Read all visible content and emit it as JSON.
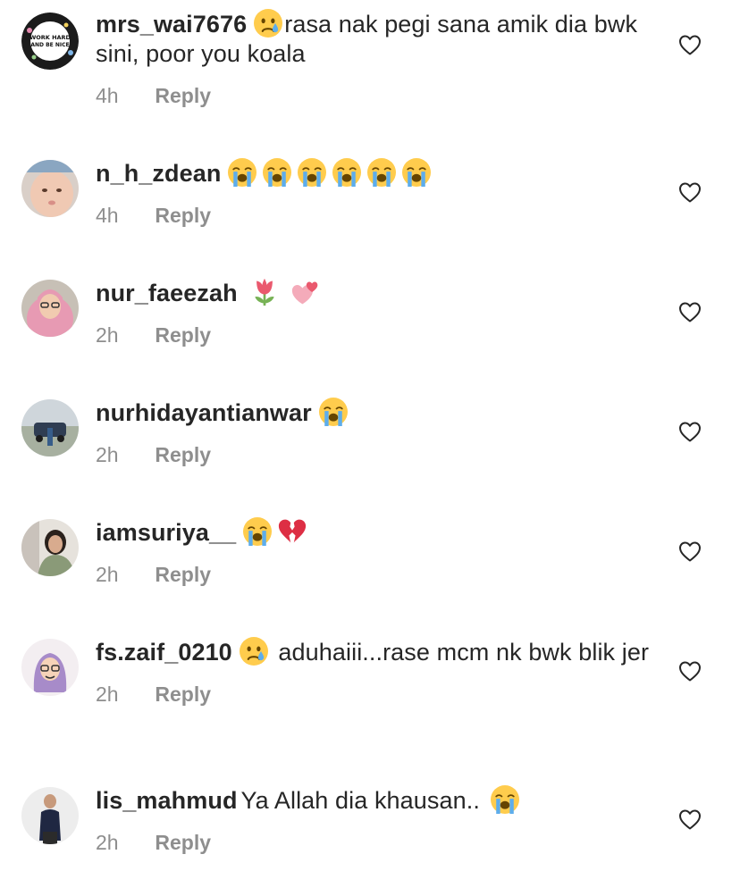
{
  "comments": [
    {
      "username": "mrs_wai7676",
      "emoji_before": [
        "crying-face"
      ],
      "text": "rasa nak pegi sana amik dia bwk sini, poor you koala",
      "emoji_after": [],
      "time": "4h",
      "reply_label": "Reply",
      "avatar_text": "WORK HARD AND BE NICE"
    },
    {
      "username": "n_h_zdean",
      "emoji_before": [],
      "text": "",
      "emoji_after": [
        "loudly-crying-face",
        "loudly-crying-face",
        "loudly-crying-face",
        "loudly-crying-face",
        "loudly-crying-face",
        "loudly-crying-face"
      ],
      "time": "4h",
      "reply_label": "Reply"
    },
    {
      "username": "nur_faeezah",
      "emoji_before": [],
      "text": "",
      "emoji_after": [
        "tulip",
        "two-hearts"
      ],
      "time": "2h",
      "reply_label": "Reply"
    },
    {
      "username": "nurhidayantianwar",
      "emoji_before": [],
      "text": "",
      "emoji_after": [
        "loudly-crying-face"
      ],
      "time": "2h",
      "reply_label": "Reply"
    },
    {
      "username": "iamsuriya__",
      "emoji_before": [],
      "text": "",
      "emoji_after": [
        "loudly-crying-face",
        "broken-heart"
      ],
      "time": "2h",
      "reply_label": "Reply"
    },
    {
      "username": "fs.zaif_0210",
      "emoji_before": [
        "crying-face"
      ],
      "text": " aduhaiii...rase mcm nk bwk blik jer",
      "emoji_after": [],
      "time": "2h",
      "reply_label": "Reply"
    },
    {
      "username": "lis_mahmud",
      "emoji_before": [],
      "text": "Ya Allah dia khausan..",
      "emoji_after": [
        "loudly-crying-face"
      ],
      "time": "2h",
      "reply_label": "Reply"
    }
  ],
  "colors": {
    "text": "#262626",
    "secondary": "#8e8e8e",
    "emoji_yellow": "#FFCC4D",
    "tear_blue": "#5DADEC",
    "heart_red": "#DD2E44"
  },
  "icons": {
    "like": "heart-outline-icon"
  }
}
